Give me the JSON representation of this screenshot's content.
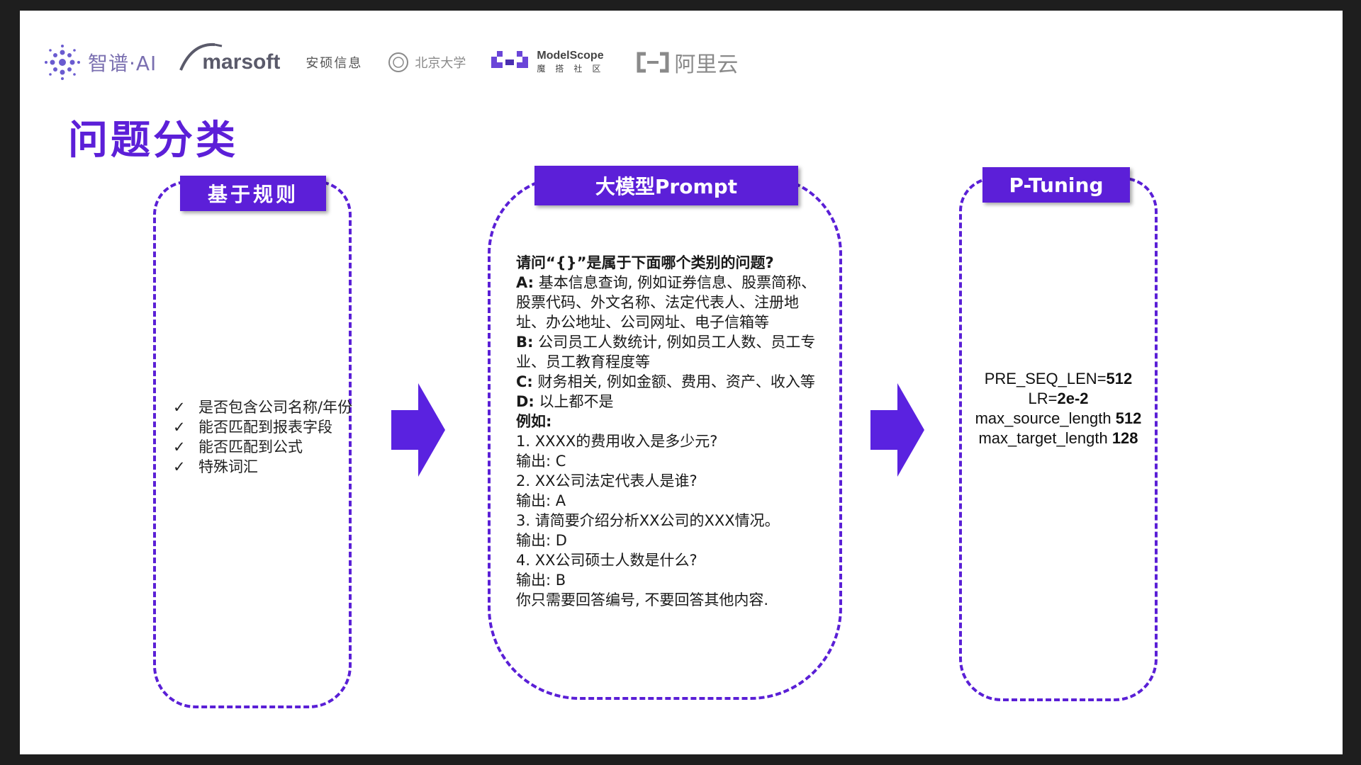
{
  "logos": {
    "zhipu": "智谱·AI",
    "marsoft": "marsoft",
    "anshuo": "安硕信息",
    "pku": "北京大学",
    "modelscope_en": "ModelScope",
    "modelscope_cn": "魔搭社区",
    "aliyun": "阿里云"
  },
  "title": "问题分类",
  "rules_panel": {
    "header": "基于规则",
    "items": [
      {
        "check": "✓",
        "text": "是否包含公司名称/年份"
      },
      {
        "check": "✓",
        "text": "能否匹配到报表字段"
      },
      {
        "check": "✓",
        "text": "能否匹配到公式"
      },
      {
        "check": "✓",
        "text": "特殊词汇"
      }
    ]
  },
  "prompt_panel": {
    "header": "大模型Prompt",
    "question": "请问“{}”是属于下面哪个类别的问题?",
    "options": [
      {
        "key": "A:",
        "text": " 基本信息查询, 例如证券信息、股票简称、股票代码、外文名称、法定代表人、注册地址、办公地址、公司网址、电子信箱等"
      },
      {
        "key": "B:",
        "text": " 公司员工人数统计, 例如员工人数、员工专业、员工教育程度等"
      },
      {
        "key": "C:",
        "text": " 财务相关, 例如金额、费用、资产、收入等"
      },
      {
        "key": "D:",
        "text": " 以上都不是"
      }
    ],
    "examples_label": "例如:",
    "examples": [
      {
        "q": "1. XXXX的费用收入是多少元?",
        "a": "输出: C"
      },
      {
        "q": "2. XX公司法定代表人是谁?",
        "a": "输出: A"
      },
      {
        "q": "3. 请简要介绍分析XX公司的XXX情况。",
        "a": "输出: D"
      },
      {
        "q": "4. XX公司硕士人数是什么?",
        "a": "输出: B"
      }
    ],
    "footer": "你只需要回答编号, 不要回答其他内容."
  },
  "ptuning_panel": {
    "header": "P-Tuning",
    "params": [
      {
        "name": "PRE_SEQ_LEN=",
        "value": "512"
      },
      {
        "name": "LR=",
        "value": "2e-2"
      },
      {
        "name": "max_source_length ",
        "value": "512"
      },
      {
        "name": "max_target_length ",
        "value": "128"
      }
    ]
  },
  "colors": {
    "accent": "#5c1fd8",
    "arrow": "#5a22e0"
  }
}
